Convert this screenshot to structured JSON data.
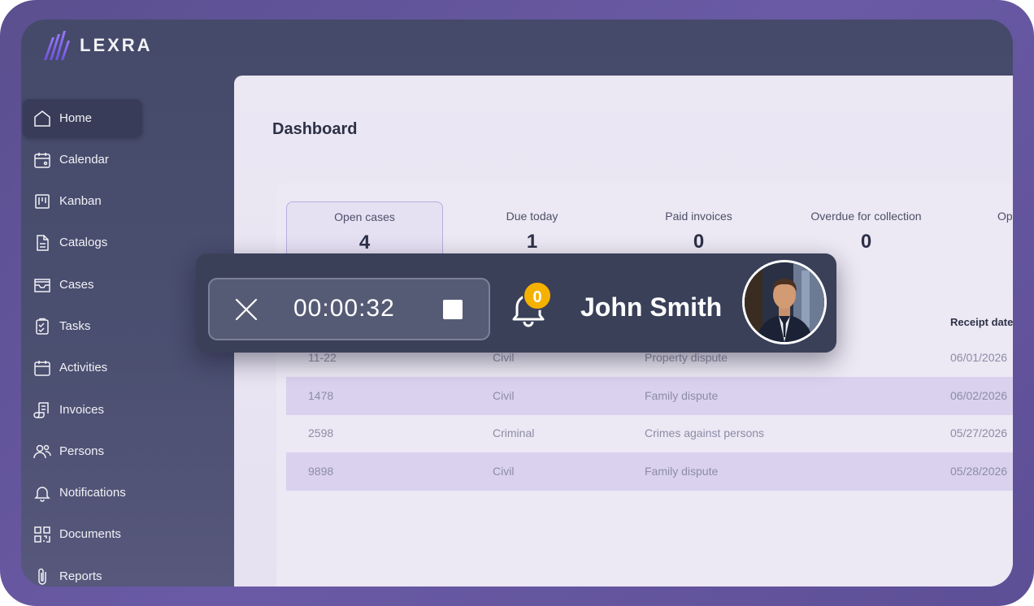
{
  "app": {
    "logo_text": "LEXRA",
    "accent": "#6c5ce7"
  },
  "sidebar": {
    "items": [
      {
        "label": "Home",
        "icon": "home-icon",
        "active": true
      },
      {
        "label": "Calendar",
        "icon": "calendar-icon"
      },
      {
        "label": "Kanban",
        "icon": "kanban-icon"
      },
      {
        "label": "Catalogs",
        "icon": "document-icon"
      },
      {
        "label": "Cases",
        "icon": "inbox-icon"
      },
      {
        "label": "Tasks",
        "icon": "clipboard-check-icon"
      },
      {
        "label": "Activities",
        "icon": "calendar-blank-icon"
      },
      {
        "label": "Invoices",
        "icon": "scroll-icon"
      },
      {
        "label": "Persons",
        "icon": "users-icon"
      },
      {
        "label": "Notifications",
        "icon": "bell-icon"
      },
      {
        "label": "Documents",
        "icon": "qr-code-icon"
      },
      {
        "label": "Reports",
        "icon": "paperclip-icon"
      }
    ]
  },
  "main": {
    "title": "Dashboard",
    "stats": [
      {
        "label": "Open cases",
        "value": "4"
      },
      {
        "label": "Due today",
        "value": "1"
      },
      {
        "label": "Paid invoices",
        "value": "0"
      },
      {
        "label": "Overdue for collection",
        "value": "0"
      },
      {
        "label": "Op",
        "value": ""
      }
    ],
    "table": {
      "visible_header": "Receipt date",
      "rows": [
        {
          "number": "11-22",
          "type": "Civil",
          "subject": "Property dispute",
          "date": "06/01/2026"
        },
        {
          "number": "1478",
          "type": "Civil",
          "subject": "Family dispute",
          "date": "06/02/2026"
        },
        {
          "number": "2598",
          "type": "Criminal",
          "subject": "Crimes against persons",
          "date": "05/27/2026"
        },
        {
          "number": "9898",
          "type": "Civil",
          "subject": "Family dispute",
          "date": "05/28/2026"
        }
      ]
    }
  },
  "timer": {
    "elapsed": "00:00:32",
    "notification_count": "0",
    "user_name": "John Smith",
    "badge_color": "#f5b100"
  }
}
